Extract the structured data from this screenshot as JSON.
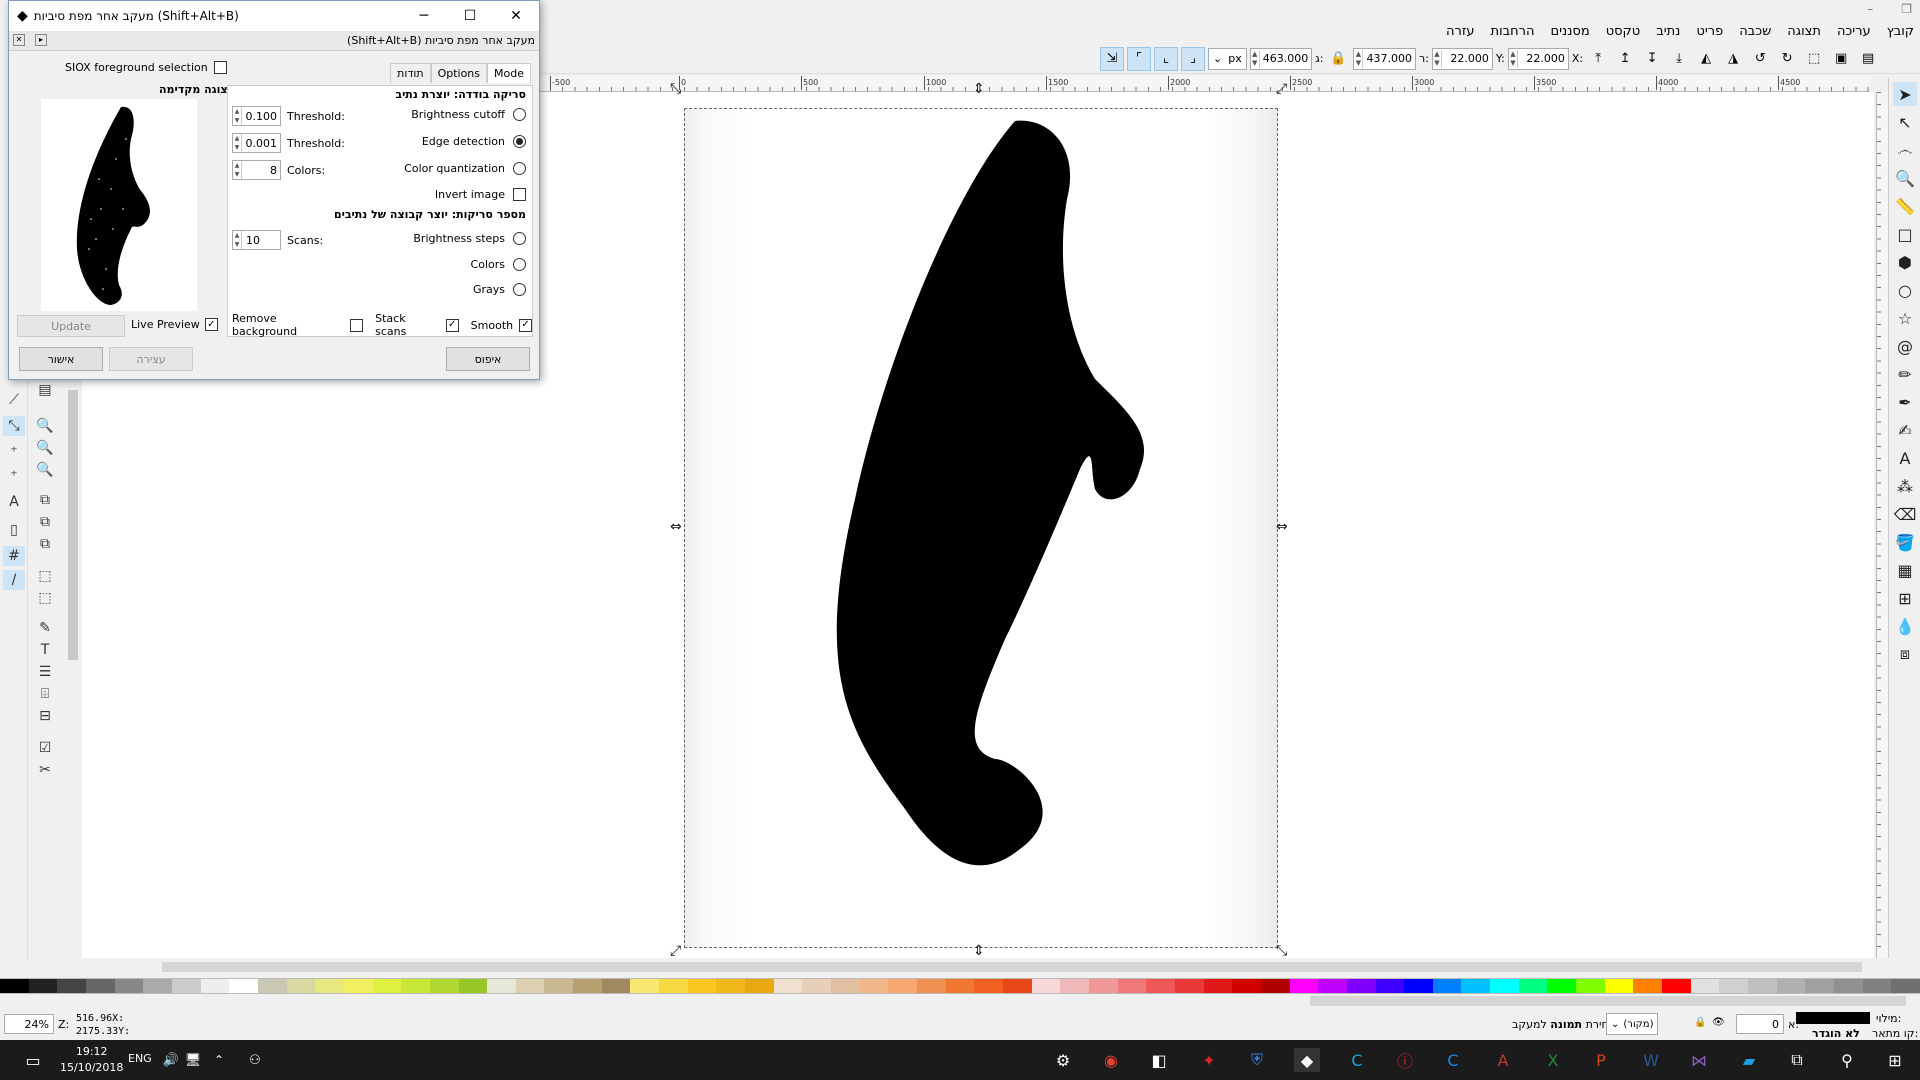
{
  "window_controls": {
    "minimize": "–",
    "restore": "❐"
  },
  "menu": [
    "קובץ",
    "עריכה",
    "תצוגה",
    "שכבה",
    "פריט",
    "נתיב",
    "טקסט",
    "מסננים",
    "הרחבות",
    "עזרה"
  ],
  "toolbar": {
    "unit": "px",
    "x_label": "X:",
    "x_value": "22.000",
    "y_label": "Y:",
    "y_value": "22.000",
    "w_label": "ר:",
    "w_value": "437.000",
    "h_label": "ג:",
    "h_value": "463.000"
  },
  "ruler_ticks": [
    "-500",
    "0",
    "500",
    "1000",
    "1500",
    "2000",
    "2500",
    "3000",
    "3500",
    "4000",
    "4500"
  ],
  "dialog": {
    "title": "מעקב אחר מפת סיביות (Shift+Alt+B)",
    "subtitle": "מעקב אחר מפת סיביות (Shift+Alt+B)",
    "siox_label": "SIOX foreground selection",
    "preview_title": "תצוגה מקדימה",
    "update_label": "Update",
    "live_preview_label": "Live Preview",
    "ok_label": "אישור",
    "cancel_label": "עצירה",
    "reset_label": "איפוס",
    "tabs": [
      "Mode",
      "Options",
      "תודות"
    ],
    "single_scan_title": "סריקה בודדה: יוצרת נתיב",
    "multi_scan_title": "מספר סריקות: יוצר קבוצה של נתיבים",
    "brightness_cutoff": "Brightness cutoff",
    "edge_detection": "Edge detection",
    "color_quantization": "Color quantization",
    "invert_image": "Invert image",
    "brightness_steps": "Brightness steps",
    "colors": "Colors",
    "grays": "Grays",
    "remove_background": "Remove background",
    "stack_scans": "Stack scans",
    "smooth": "Smooth",
    "threshold_label": "Threshold:",
    "colors_label": "Colors:",
    "scans_label": "Scans:",
    "threshold1_value": "0.100",
    "threshold2_value": "0.001",
    "colors_value": "8",
    "scans_value": "10"
  },
  "statusbar": {
    "zoom_value": "24%",
    "zoom_label": "Z:",
    "x_coord": "516.96",
    "x_label": "X:",
    "y_coord": "2175.33",
    "y_label": "Y:",
    "message_prefix": "בחירת",
    "message_bold": "תמונה",
    "message_suffix": "למעקב",
    "layer": "(מקור)",
    "opacity_value": "0",
    "opacity_label": "א:",
    "fill_label": "מילוי:",
    "stroke_label": "קו מתאר:",
    "stroke_value": "לא הוגדר"
  },
  "taskbar": {
    "time": "19:12",
    "date": "15/10/2018",
    "lang": "ENG"
  },
  "colors": {
    "accent": "#cde4f7",
    "dialog_border": "#7a9cc6",
    "taskbar": "#1b1b1b"
  }
}
